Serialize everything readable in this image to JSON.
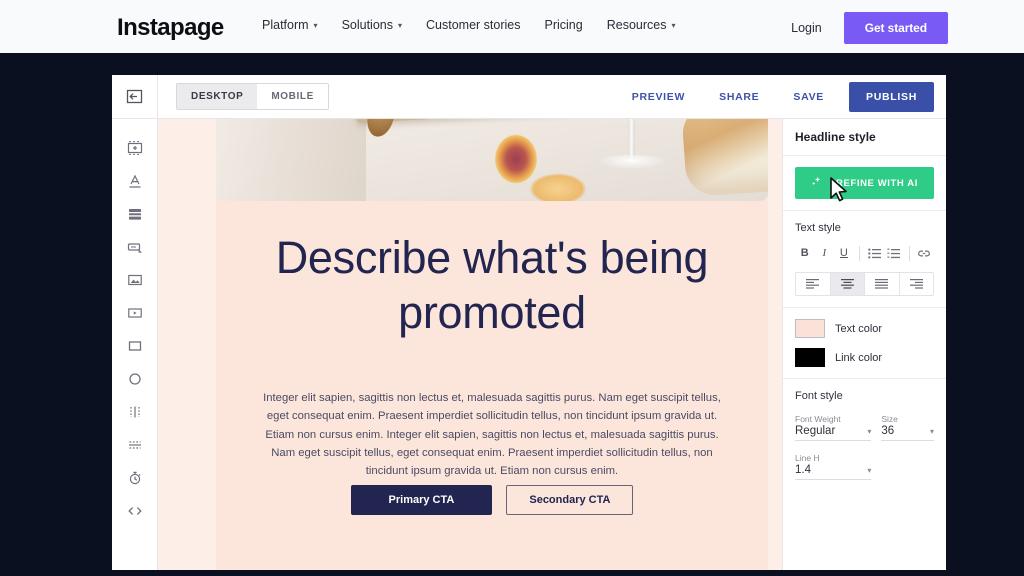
{
  "navbar": {
    "logo": "Instapage",
    "links": [
      {
        "label": "Platform",
        "caret": "chevron-down"
      },
      {
        "label": "Solutions",
        "caret": "chevron-down"
      },
      {
        "label": "Customer stories",
        "caret": ""
      },
      {
        "label": "Pricing",
        "caret": ""
      },
      {
        "label": "Resources",
        "caret": "chevron-down"
      }
    ],
    "login_label": "Login",
    "get_started_label": "Get started",
    "accent_color": "#7a5af5",
    "background_color": "#f8fafb"
  },
  "editor": {
    "back_icon": "collapse-panel-icon",
    "devices": [
      {
        "label": "DESKTOP",
        "active": true
      },
      {
        "label": "MOBILE",
        "active": false
      }
    ],
    "actions": [
      {
        "label": "PREVIEW"
      },
      {
        "label": "SHARE"
      },
      {
        "label": "SAVE"
      }
    ],
    "publish_label": "PUBLISH",
    "publish_color": "#3a4fa8",
    "rail": [
      {
        "name": "add-block-icon"
      },
      {
        "name": "text-icon"
      },
      {
        "name": "layout-rows-icon"
      },
      {
        "name": "button-icon"
      },
      {
        "name": "image-icon"
      },
      {
        "name": "video-icon"
      },
      {
        "name": "box-icon"
      },
      {
        "name": "circle-icon"
      },
      {
        "name": "columns-icon"
      },
      {
        "name": "divider-icon"
      },
      {
        "name": "timer-icon"
      },
      {
        "name": "code-icon"
      }
    ]
  },
  "canvas": {
    "background_color": "#fce6dc",
    "hero_image_alt": "peach, wine glass, bread and wooden board on white cloth",
    "headline": "Describe what's being promoted",
    "headline_color": "#22254f",
    "body_copy": "Integer elit sapien, sagittis non lectus et, malesuada sagittis purus. Nam eget suscipit tellus, eget consequat enim. Praesent imperdiet sollicitudin tellus, non tincidunt ipsum gravida ut. Etiam non cursus enim. Integer elit sapien, sagittis non lectus et, malesuada sagittis purus. Nam eget suscipit tellus, eget consequat enim. Praesent imperdiet sollicitudin tellus, non tincidunt ipsum gravida ut. Etiam non cursus enim.",
    "primary_cta": "Primary CTA",
    "secondary_cta": "Secondary CTA"
  },
  "panel": {
    "title": "Headline style",
    "ai_button": {
      "label": "REFINE WITH AI",
      "icon": "sparkle-icon",
      "color": "#2ecc87"
    },
    "text_style": {
      "label": "Text style",
      "format_buttons": [
        {
          "name": "bold-icon",
          "glyph": "B"
        },
        {
          "name": "italic-icon",
          "glyph": "I"
        },
        {
          "name": "underline-icon",
          "glyph": "U"
        }
      ],
      "list_buttons": [
        {
          "name": "bullet-list-icon"
        },
        {
          "name": "numbered-list-icon"
        }
      ],
      "link_button": {
        "name": "link-icon"
      },
      "align_buttons": [
        {
          "name": "align-left-icon",
          "active": false
        },
        {
          "name": "align-center-icon",
          "active": true
        },
        {
          "name": "align-justify-icon",
          "active": false
        },
        {
          "name": "align-right-icon",
          "active": false
        }
      ],
      "colors": [
        {
          "label": "Text color",
          "value": "#fbe2d8"
        },
        {
          "label": "Link color",
          "value": "#000000"
        }
      ]
    },
    "font_style": {
      "label": "Font style",
      "fields": [
        {
          "label": "Font Weight",
          "value": "Regular"
        },
        {
          "label": "Size",
          "value": "36"
        },
        {
          "label": "Line H",
          "value": "1.4"
        }
      ]
    }
  }
}
